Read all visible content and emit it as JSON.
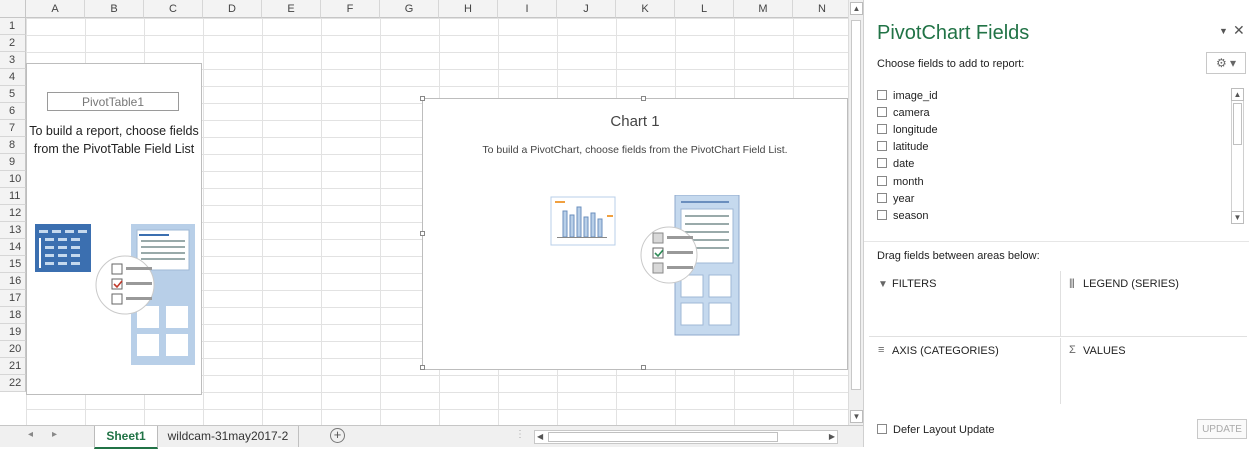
{
  "columns": [
    "A",
    "B",
    "C",
    "D",
    "E",
    "F",
    "G",
    "H",
    "I",
    "J",
    "K",
    "L",
    "M",
    "N"
  ],
  "rows": [
    "1",
    "2",
    "3",
    "4",
    "5",
    "6",
    "7",
    "8",
    "9",
    "10",
    "11",
    "12",
    "13",
    "14",
    "15",
    "16",
    "17",
    "18",
    "19",
    "20",
    "21",
    "22"
  ],
  "pivot_table": {
    "name": "PivotTable1",
    "message": "To build a report, choose fields from the PivotTable Field List"
  },
  "chart": {
    "title": "Chart 1",
    "message": "To build a PivotChart, choose fields from the PivotChart Field List."
  },
  "sheet_tabs": [
    {
      "label": "Sheet1",
      "active": true
    },
    {
      "label": "wildcam-31may2017-2",
      "active": false
    }
  ],
  "add_sheet_icon": "plus-circle-icon",
  "pane": {
    "title": "PivotChart Fields",
    "choose_label": "Choose fields to add to report:",
    "fields": [
      {
        "label": "image_id",
        "checked": false
      },
      {
        "label": "camera",
        "checked": false
      },
      {
        "label": "longitude",
        "checked": false
      },
      {
        "label": "latitude",
        "checked": false
      },
      {
        "label": "date",
        "checked": false
      },
      {
        "label": "month",
        "checked": false
      },
      {
        "label": "year",
        "checked": false
      },
      {
        "label": "season",
        "checked": false
      }
    ],
    "drag_label": "Drag fields between areas below:",
    "areas": {
      "filters": "FILTERS",
      "legend": "LEGEND (SERIES)",
      "axis": "AXIS (CATEGORIES)",
      "values": "VALUES"
    },
    "defer_label": "Defer Layout Update",
    "update_label": "UPDATE"
  },
  "colors": {
    "accent_green": "#217346",
    "pivot_blue": "#3b6fb0",
    "light_blue": "#c5d9ee"
  }
}
